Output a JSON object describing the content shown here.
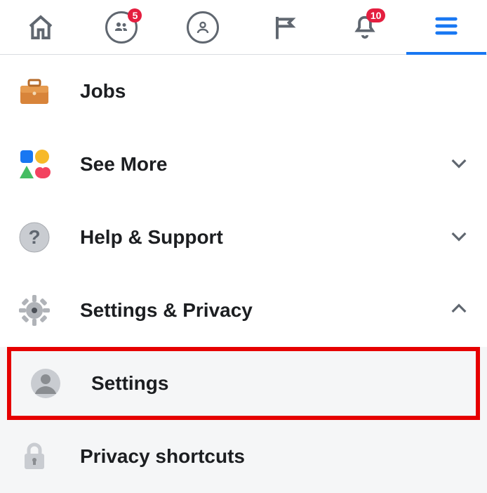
{
  "topbar": {
    "friends_badge": "5",
    "notifications_badge": "10"
  },
  "menu": {
    "jobs": "Jobs",
    "see_more": "See More",
    "help_support": "Help & Support",
    "settings_privacy": "Settings & Privacy",
    "settings": "Settings",
    "privacy_shortcuts": "Privacy shortcuts"
  }
}
